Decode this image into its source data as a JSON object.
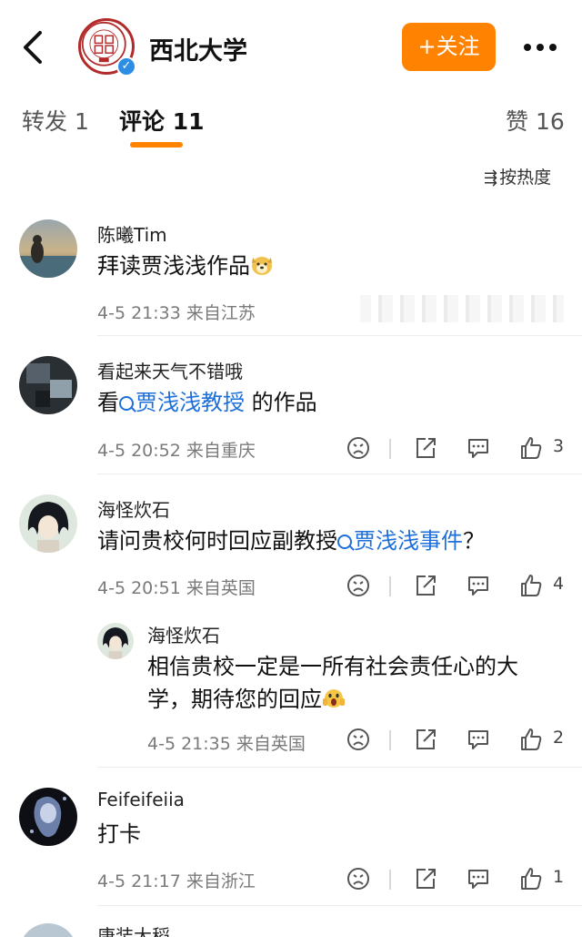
{
  "header": {
    "account_name": "西北大学",
    "follow_label": "+关注",
    "logo_text": "NORTHWEST UNIVERSITY XI'AN CHINA 1902"
  },
  "tabs": [
    {
      "label": "转发 1"
    },
    {
      "label": "评论 11",
      "active": true
    },
    {
      "label": "赞 16"
    }
  ],
  "sort": {
    "label": "按热度"
  },
  "colors": {
    "accent": "#ff8200",
    "link": "#1e6fd9",
    "verified": "#2b8de3"
  },
  "comments": [
    {
      "user": "陈曦Tim",
      "text": "拜读贾浅浅作品",
      "emoji": "doge-emoji",
      "time": "4-5 21:33",
      "location": "来自江苏"
    },
    {
      "user": "看起来天气不错哦",
      "text_prefix": "看",
      "link": "贾浅浅教授",
      "text_suffix": " 的作品",
      "time": "4-5 20:52",
      "location": "来自重庆",
      "likes": "3"
    },
    {
      "user": "海怪炊石",
      "text_prefix": "请问贵校何时回应副教授",
      "link": "贾浅浅事件",
      "text_suffix": "？",
      "time": "4-5 20:51",
      "location": "来自英国",
      "likes": "4"
    },
    {
      "user": "海怪炊石",
      "text_line1": "相信贵校一定是一所有社会责任心的大",
      "text_line2": "学，期待您的回应",
      "emoji": "scream-emoji",
      "time": "4-5 21:35",
      "location": "来自英国",
      "likes": "2"
    },
    {
      "user": "Feifeifeiia",
      "text": "打卡",
      "time": "4-5 21:17",
      "location": "来自浙江",
      "likes": "1"
    },
    {
      "user": "唐装大稻"
    }
  ]
}
